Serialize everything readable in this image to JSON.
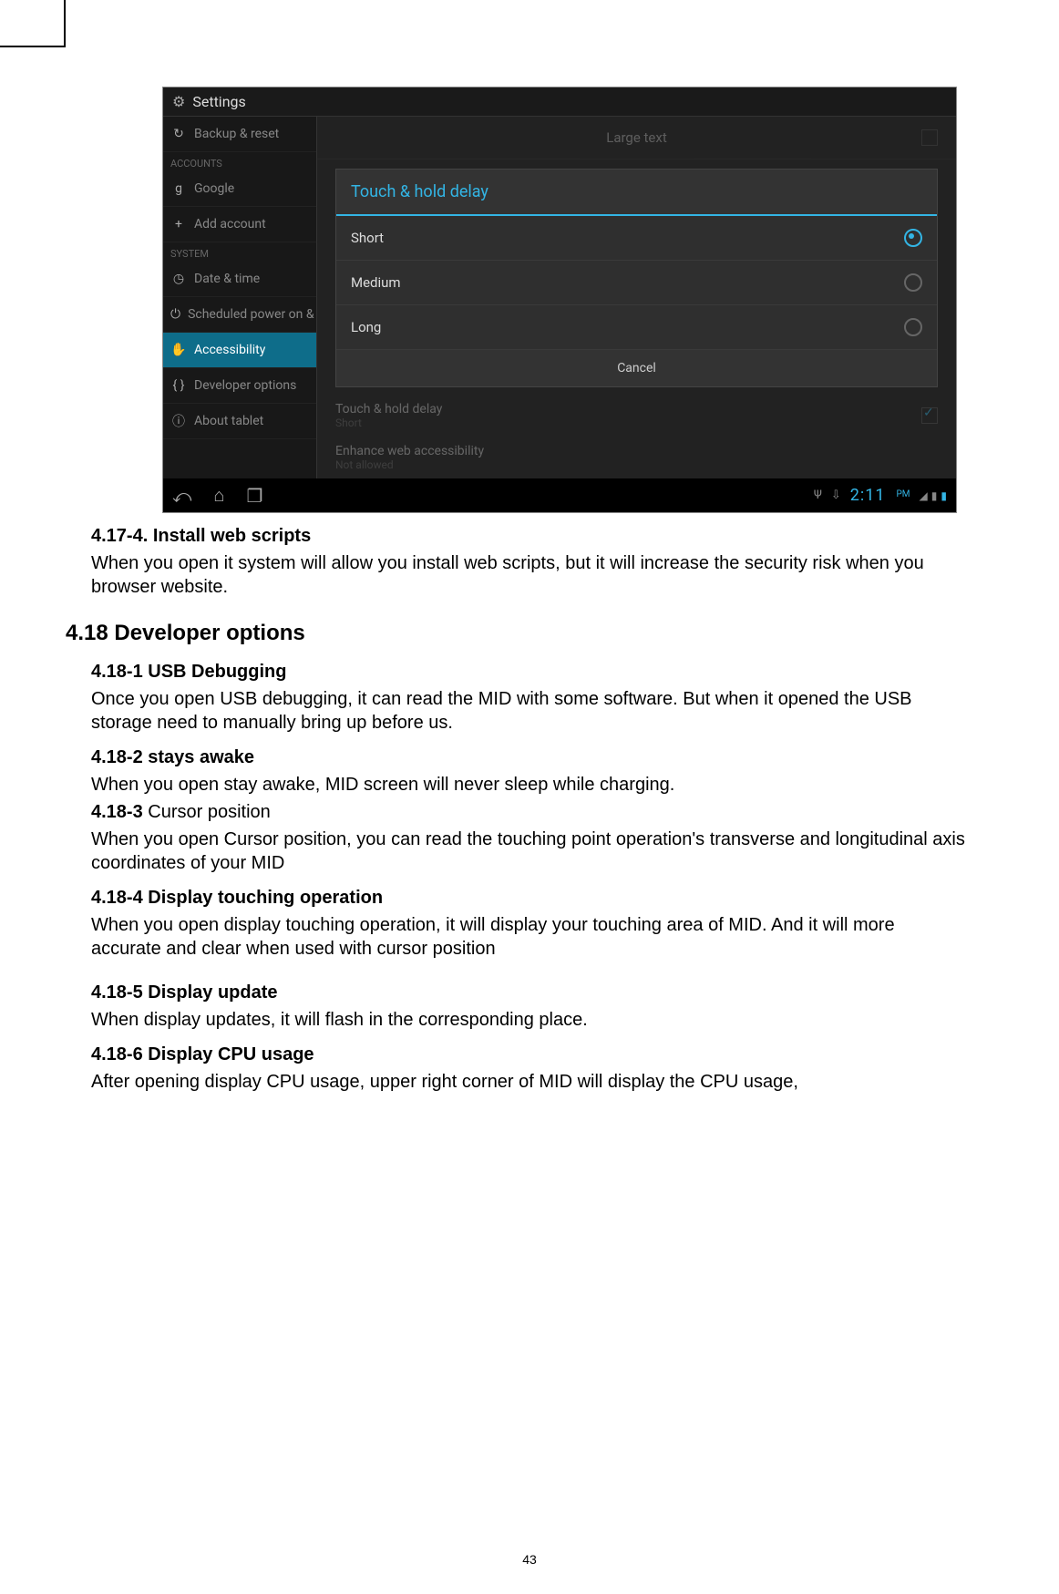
{
  "page_number": "43",
  "screenshot": {
    "header_title": "Settings",
    "sidebar": {
      "items_top": [
        {
          "icon": "↻",
          "label": "Backup & reset"
        }
      ],
      "section1": "ACCOUNTS",
      "accounts": [
        {
          "icon": "g",
          "label": "Google"
        },
        {
          "icon": "+",
          "label": "Add account"
        }
      ],
      "section2": "SYSTEM",
      "system": [
        {
          "icon": "◷",
          "label": "Date & time"
        },
        {
          "icon": "⏻",
          "label": "Scheduled power on & off"
        },
        {
          "icon": "✋",
          "label": "Accessibility",
          "active": true
        },
        {
          "icon": "{ }",
          "label": "Developer options"
        },
        {
          "icon": "ⓘ",
          "label": "About tablet"
        }
      ]
    },
    "main": {
      "large_text": "Large text",
      "touch_hold_label": "Touch & hold delay",
      "touch_hold_value": "Short",
      "enhance_label": "Enhance web accessibility",
      "enhance_value": "Not allowed"
    },
    "dialog": {
      "title": "Touch & hold delay",
      "options": [
        "Short",
        "Medium",
        "Long"
      ],
      "selected": 0,
      "cancel": "Cancel"
    },
    "statusbar": {
      "time": "2:11",
      "ampm": "PM"
    }
  },
  "doc": {
    "h_4_17_4": "4.17-4. Install web scripts",
    "p_4_17_4": "When you open it system will allow you install web scripts, but it will increase the security risk when you browser website.",
    "h_4_18": "4.18 Developer options",
    "h_4_18_1": "4.18-1 USB Debugging",
    "p_4_18_1": "Once you open USB debugging, it can read the MID with some software. But when it opened the USB storage need to manually bring up before us.",
    "h_4_18_2": "4.18-2 stays awake",
    "p_4_18_2": "When you open stay awake, MID screen will never sleep while charging.",
    "h_4_18_3_prefix": "4.18-3 ",
    "h_4_18_3_rest": "Cursor position",
    "p_4_18_3": "When you open Cursor position, you can read the touching point operation's transverse and longitudinal axis coordinates of your MID",
    "h_4_18_4": "4.18-4 Display touching operation",
    "p_4_18_4": "When you open display touching operation, it will display your touching area of MID. And it will more accurate and clear when used with cursor position",
    "h_4_18_5": "4.18-5 Display update",
    "p_4_18_5": "When display updates, it will flash in the corresponding place.",
    "h_4_18_6": "4.18-6 Display CPU usage",
    "p_4_18_6": "After opening display CPU usage, upper right corner of MID will display the CPU usage,"
  }
}
